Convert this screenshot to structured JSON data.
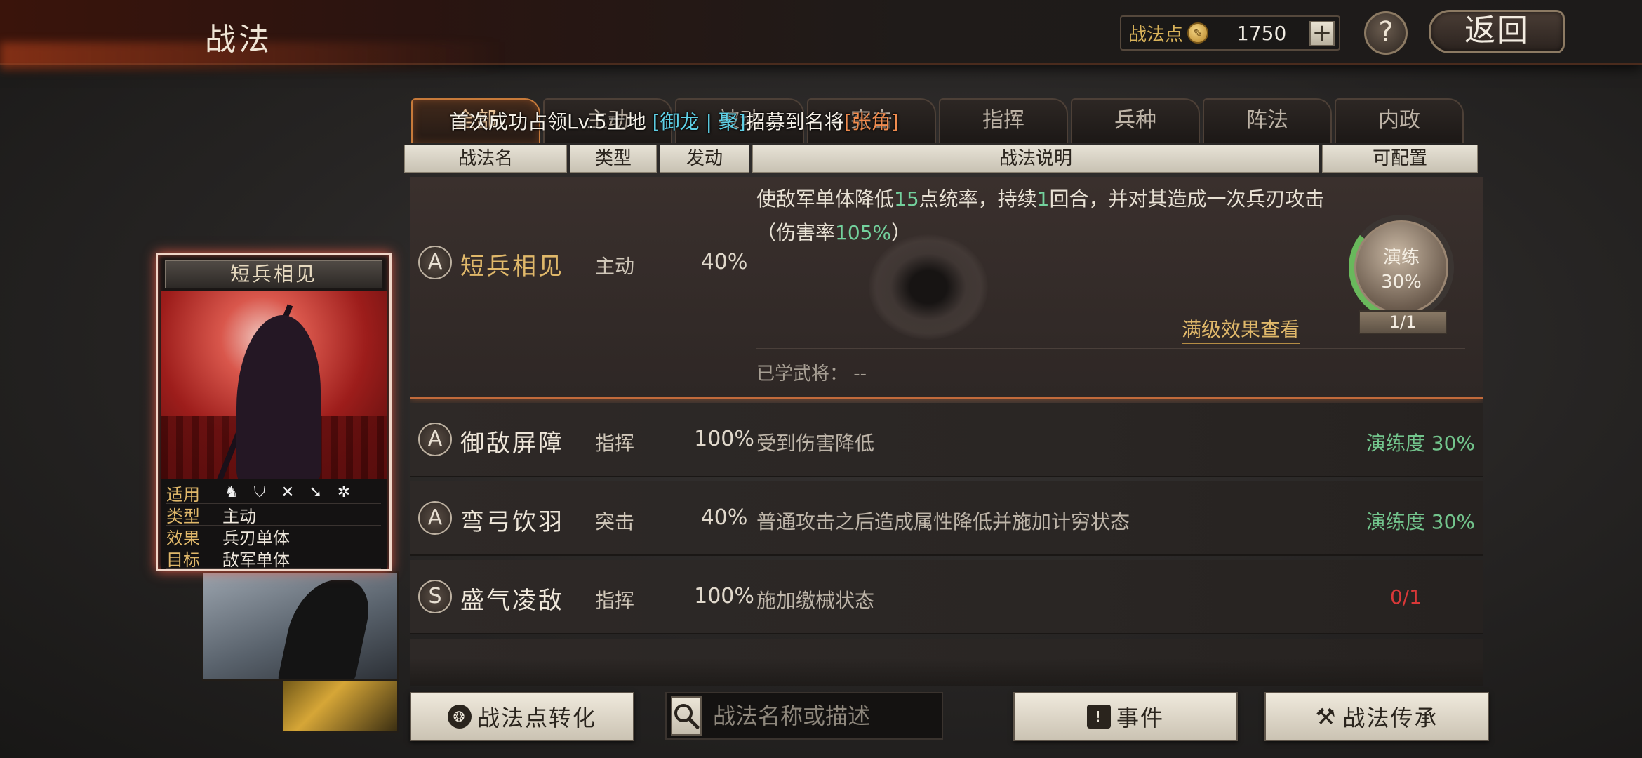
{
  "header": {
    "title": "战法",
    "points_label": "战法点",
    "points_value": "1750",
    "plus_label": "+",
    "help_label": "?",
    "back_label": "返回"
  },
  "tabs": [
    {
      "label": "全部",
      "active": true
    },
    {
      "label": "主动",
      "active": false
    },
    {
      "label": "被动",
      "active": false
    },
    {
      "label": "突击",
      "active": false
    },
    {
      "label": "指挥",
      "active": false
    },
    {
      "label": "兵种",
      "active": false
    },
    {
      "label": "阵法",
      "active": false
    },
    {
      "label": "内政",
      "active": false
    }
  ],
  "notice": {
    "part1": "首次成功占领Lv.5土地",
    "tag1": "[御龙",
    "tag2": "| 聚]",
    "part2": "招募到名将",
    "tag3": "[张角]"
  },
  "columns": {
    "name": "战法名",
    "type": "类型",
    "trigger": "发动",
    "desc": "战法说明",
    "config": "可配置"
  },
  "expanded": {
    "grade": "A",
    "name": "短兵相见",
    "type": "主动",
    "rate": "40%",
    "desc_a": "使敌军单体降低",
    "desc_hl1": "15",
    "desc_b": "点统率，持续",
    "desc_hl2": "1",
    "desc_c": "回合，并对其造成一次兵刃攻击（伤害率",
    "desc_hl3": "105%",
    "desc_d": "）",
    "full_effect": "满级效果查看",
    "learned_label": "已学武将：",
    "learned_value": "--",
    "train_label": "演练",
    "train_pct": "30%",
    "train_count": "1/1"
  },
  "rows": [
    {
      "grade": "A",
      "name": "御敌屏障",
      "type": "指挥",
      "rate": "100%",
      "desc": "受到伤害降低",
      "config": "演练度 30%"
    },
    {
      "grade": "A",
      "name": "弯弓饮羽",
      "type": "突击",
      "rate": "40%",
      "desc": "普通攻击之后造成属性降低并施加计穷状态",
      "config": "演练度 30%"
    },
    {
      "grade": "S",
      "name": "盛气凌敌",
      "type": "指挥",
      "rate": "100%",
      "desc": "施加缴械状态",
      "config": "0/1"
    }
  ],
  "card": {
    "title": "短兵相见",
    "apply_label": "适用",
    "type_label": "类型",
    "type_value": "主动",
    "effect_label": "效果",
    "effect_value": "兵刃单体",
    "target_label": "目标",
    "target_value": "敌军单体",
    "unit_icons": [
      "cavalry-icon",
      "shield-icon",
      "archer-icon",
      "spear-icon",
      "siege-icon"
    ]
  },
  "bottom": {
    "convert_label": "战法点转化",
    "search_placeholder": "战法名称或描述",
    "event_label": "事件",
    "inherit_label": "战法传承"
  },
  "colors": {
    "accent_gold": "#e0b86a",
    "train_green": "#72c48c",
    "highlight_green": "#73d19d",
    "alert_red": "#d83838",
    "active_border": "#c77a3a"
  }
}
